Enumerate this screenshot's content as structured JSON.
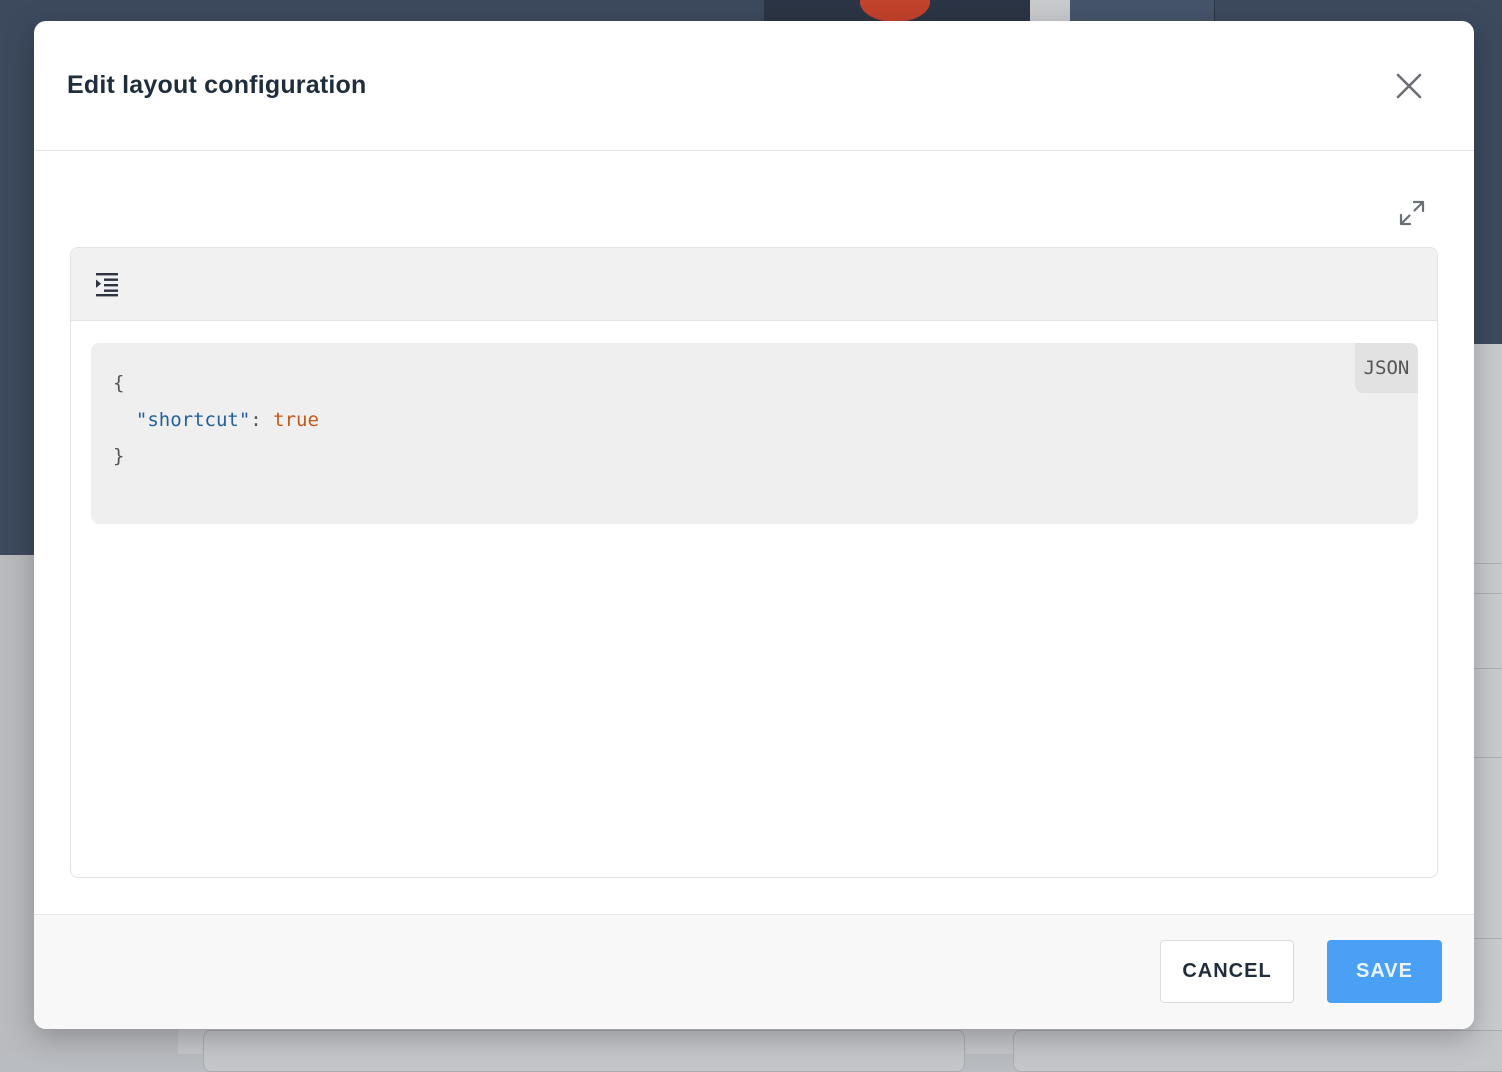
{
  "modal": {
    "title": "Edit layout configuration",
    "close_icon": "close-icon",
    "expand_icon": "expand-icon"
  },
  "editor": {
    "toolbar": {
      "indent_icon": "format-indent-icon"
    },
    "language": "JSON",
    "code": {
      "open_brace": "{",
      "key": "\"shortcut\"",
      "separator": ": ",
      "value": "true",
      "close_brace": "}"
    },
    "status": {
      "icon": "check-icon",
      "state": "valid",
      "indicator_color": "#f07020"
    }
  },
  "footer": {
    "cancel_label": "CANCEL",
    "save_label": "SAVE"
  },
  "colors": {
    "accent": "#4aa0f5",
    "json_key": "#22609a",
    "json_boolean": "#c05a1a"
  }
}
